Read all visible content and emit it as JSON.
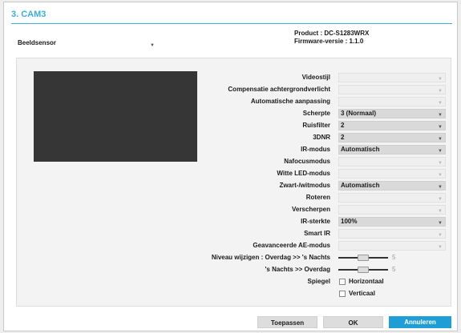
{
  "window": {
    "title": "3. CAM3",
    "accent_color": "#3aaed8"
  },
  "device": {
    "product": "Product : DC-S1283WRX",
    "firmware": "Firmware-versie : 1.1.0"
  },
  "category_select": {
    "value": "Beeldsensor",
    "icon": "chevron-down-icon"
  },
  "settings": [
    {
      "key": "videostijl",
      "label": "Videostijl",
      "type": "select",
      "value": "",
      "enabled": false
    },
    {
      "key": "blc",
      "label": "Compensatie achtergrondverlicht",
      "type": "select",
      "value": "",
      "enabled": false
    },
    {
      "key": "auto_adjust",
      "label": "Automatische aanpassing",
      "type": "select",
      "value": "",
      "enabled": false
    },
    {
      "key": "scherpte",
      "label": "Scherpte",
      "type": "select",
      "value": "3 (Normaal)",
      "enabled": true
    },
    {
      "key": "ruisfilter",
      "label": "Ruisfilter",
      "type": "select",
      "value": "2",
      "enabled": true
    },
    {
      "key": "3dnr",
      "label": "3DNR",
      "type": "select",
      "value": "2",
      "enabled": true
    },
    {
      "key": "ir_modus",
      "label": "IR-modus",
      "type": "select",
      "value": "Automatisch",
      "enabled": true
    },
    {
      "key": "nafocus",
      "label": "Nafocusmodus",
      "type": "select",
      "value": "",
      "enabled": false
    },
    {
      "key": "witte_led",
      "label": "Witte LED-modus",
      "type": "select",
      "value": "",
      "enabled": false
    },
    {
      "key": "zwart_wit",
      "label": "Zwart-/witmodus",
      "type": "select",
      "value": "Automatisch",
      "enabled": true
    },
    {
      "key": "roteren",
      "label": "Roteren",
      "type": "select",
      "value": "",
      "enabled": false
    },
    {
      "key": "verscherpen",
      "label": "Verscherpen",
      "type": "select",
      "value": "",
      "enabled": false
    },
    {
      "key": "ir_sterkte",
      "label": "IR-sterkte",
      "type": "select",
      "value": "100%",
      "enabled": true
    },
    {
      "key": "smart_ir",
      "label": "Smart IR",
      "type": "select",
      "value": "",
      "enabled": false
    },
    {
      "key": "adv_ae",
      "label": "Geavanceerde AE-modus",
      "type": "select",
      "value": "",
      "enabled": false
    }
  ],
  "sliders": [
    {
      "key": "day_to_night",
      "label": "Niveau wijzigen : Overdag >> 's Nachts",
      "value": "5",
      "fraction": 0.5
    },
    {
      "key": "night_to_day",
      "label": "'s Nachts  >> Overdag",
      "value": "5",
      "fraction": 0.5
    }
  ],
  "mirror": {
    "label": "Spiegel",
    "options": [
      {
        "key": "horizontal",
        "label": "Horizontaal",
        "checked": false
      },
      {
        "key": "vertical",
        "label": "Verticaal",
        "checked": false
      }
    ]
  },
  "buttons": {
    "apply": "Toepassen",
    "ok": "OK",
    "cancel": "Annuleren"
  },
  "colors": {
    "primary_button": "#1f9ed6",
    "preview_bg": "#363636"
  }
}
